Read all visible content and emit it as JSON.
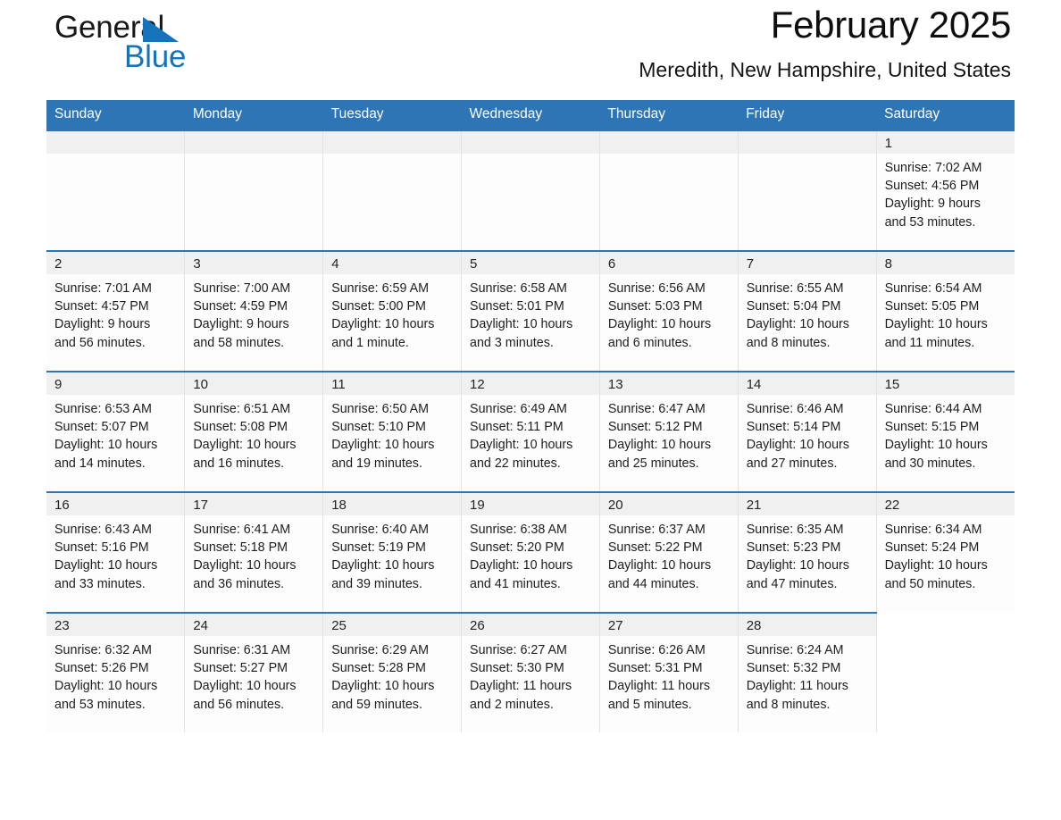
{
  "brand": {
    "word_one": "General",
    "word_two": "Blue",
    "logo_icon": "triangle-logo-icon"
  },
  "header": {
    "month_title": "February 2025",
    "location": "Meredith, New Hampshire, United States"
  },
  "colors": {
    "header_blue": "#2e75b6",
    "brand_blue": "#1573b9",
    "daynum_band": "#f0f0f0",
    "cell_background": "#fdfdfe",
    "cell_border": "#e2e2e2"
  },
  "weekdays": [
    "Sunday",
    "Monday",
    "Tuesday",
    "Wednesday",
    "Thursday",
    "Friday",
    "Saturday"
  ],
  "weeks": [
    [
      {
        "day": "",
        "sunrise": "",
        "sunset": "",
        "daylight_line1": "",
        "daylight_line2": ""
      },
      {
        "day": "",
        "sunrise": "",
        "sunset": "",
        "daylight_line1": "",
        "daylight_line2": ""
      },
      {
        "day": "",
        "sunrise": "",
        "sunset": "",
        "daylight_line1": "",
        "daylight_line2": ""
      },
      {
        "day": "",
        "sunrise": "",
        "sunset": "",
        "daylight_line1": "",
        "daylight_line2": ""
      },
      {
        "day": "",
        "sunrise": "",
        "sunset": "",
        "daylight_line1": "",
        "daylight_line2": ""
      },
      {
        "day": "",
        "sunrise": "",
        "sunset": "",
        "daylight_line1": "",
        "daylight_line2": ""
      },
      {
        "day": "1",
        "sunrise": "Sunrise: 7:02 AM",
        "sunset": "Sunset: 4:56 PM",
        "daylight_line1": "Daylight: 9 hours",
        "daylight_line2": "and 53 minutes."
      }
    ],
    [
      {
        "day": "2",
        "sunrise": "Sunrise: 7:01 AM",
        "sunset": "Sunset: 4:57 PM",
        "daylight_line1": "Daylight: 9 hours",
        "daylight_line2": "and 56 minutes."
      },
      {
        "day": "3",
        "sunrise": "Sunrise: 7:00 AM",
        "sunset": "Sunset: 4:59 PM",
        "daylight_line1": "Daylight: 9 hours",
        "daylight_line2": "and 58 minutes."
      },
      {
        "day": "4",
        "sunrise": "Sunrise: 6:59 AM",
        "sunset": "Sunset: 5:00 PM",
        "daylight_line1": "Daylight: 10 hours",
        "daylight_line2": "and 1 minute."
      },
      {
        "day": "5",
        "sunrise": "Sunrise: 6:58 AM",
        "sunset": "Sunset: 5:01 PM",
        "daylight_line1": "Daylight: 10 hours",
        "daylight_line2": "and 3 minutes."
      },
      {
        "day": "6",
        "sunrise": "Sunrise: 6:56 AM",
        "sunset": "Sunset: 5:03 PM",
        "daylight_line1": "Daylight: 10 hours",
        "daylight_line2": "and 6 minutes."
      },
      {
        "day": "7",
        "sunrise": "Sunrise: 6:55 AM",
        "sunset": "Sunset: 5:04 PM",
        "daylight_line1": "Daylight: 10 hours",
        "daylight_line2": "and 8 minutes."
      },
      {
        "day": "8",
        "sunrise": "Sunrise: 6:54 AM",
        "sunset": "Sunset: 5:05 PM",
        "daylight_line1": "Daylight: 10 hours",
        "daylight_line2": "and 11 minutes."
      }
    ],
    [
      {
        "day": "9",
        "sunrise": "Sunrise: 6:53 AM",
        "sunset": "Sunset: 5:07 PM",
        "daylight_line1": "Daylight: 10 hours",
        "daylight_line2": "and 14 minutes."
      },
      {
        "day": "10",
        "sunrise": "Sunrise: 6:51 AM",
        "sunset": "Sunset: 5:08 PM",
        "daylight_line1": "Daylight: 10 hours",
        "daylight_line2": "and 16 minutes."
      },
      {
        "day": "11",
        "sunrise": "Sunrise: 6:50 AM",
        "sunset": "Sunset: 5:10 PM",
        "daylight_line1": "Daylight: 10 hours",
        "daylight_line2": "and 19 minutes."
      },
      {
        "day": "12",
        "sunrise": "Sunrise: 6:49 AM",
        "sunset": "Sunset: 5:11 PM",
        "daylight_line1": "Daylight: 10 hours",
        "daylight_line2": "and 22 minutes."
      },
      {
        "day": "13",
        "sunrise": "Sunrise: 6:47 AM",
        "sunset": "Sunset: 5:12 PM",
        "daylight_line1": "Daylight: 10 hours",
        "daylight_line2": "and 25 minutes."
      },
      {
        "day": "14",
        "sunrise": "Sunrise: 6:46 AM",
        "sunset": "Sunset: 5:14 PM",
        "daylight_line1": "Daylight: 10 hours",
        "daylight_line2": "and 27 minutes."
      },
      {
        "day": "15",
        "sunrise": "Sunrise: 6:44 AM",
        "sunset": "Sunset: 5:15 PM",
        "daylight_line1": "Daylight: 10 hours",
        "daylight_line2": "and 30 minutes."
      }
    ],
    [
      {
        "day": "16",
        "sunrise": "Sunrise: 6:43 AM",
        "sunset": "Sunset: 5:16 PM",
        "daylight_line1": "Daylight: 10 hours",
        "daylight_line2": "and 33 minutes."
      },
      {
        "day": "17",
        "sunrise": "Sunrise: 6:41 AM",
        "sunset": "Sunset: 5:18 PM",
        "daylight_line1": "Daylight: 10 hours",
        "daylight_line2": "and 36 minutes."
      },
      {
        "day": "18",
        "sunrise": "Sunrise: 6:40 AM",
        "sunset": "Sunset: 5:19 PM",
        "daylight_line1": "Daylight: 10 hours",
        "daylight_line2": "and 39 minutes."
      },
      {
        "day": "19",
        "sunrise": "Sunrise: 6:38 AM",
        "sunset": "Sunset: 5:20 PM",
        "daylight_line1": "Daylight: 10 hours",
        "daylight_line2": "and 41 minutes."
      },
      {
        "day": "20",
        "sunrise": "Sunrise: 6:37 AM",
        "sunset": "Sunset: 5:22 PM",
        "daylight_line1": "Daylight: 10 hours",
        "daylight_line2": "and 44 minutes."
      },
      {
        "day": "21",
        "sunrise": "Sunrise: 6:35 AM",
        "sunset": "Sunset: 5:23 PM",
        "daylight_line1": "Daylight: 10 hours",
        "daylight_line2": "and 47 minutes."
      },
      {
        "day": "22",
        "sunrise": "Sunrise: 6:34 AM",
        "sunset": "Sunset: 5:24 PM",
        "daylight_line1": "Daylight: 10 hours",
        "daylight_line2": "and 50 minutes."
      }
    ],
    [
      {
        "day": "23",
        "sunrise": "Sunrise: 6:32 AM",
        "sunset": "Sunset: 5:26 PM",
        "daylight_line1": "Daylight: 10 hours",
        "daylight_line2": "and 53 minutes."
      },
      {
        "day": "24",
        "sunrise": "Sunrise: 6:31 AM",
        "sunset": "Sunset: 5:27 PM",
        "daylight_line1": "Daylight: 10 hours",
        "daylight_line2": "and 56 minutes."
      },
      {
        "day": "25",
        "sunrise": "Sunrise: 6:29 AM",
        "sunset": "Sunset: 5:28 PM",
        "daylight_line1": "Daylight: 10 hours",
        "daylight_line2": "and 59 minutes."
      },
      {
        "day": "26",
        "sunrise": "Sunrise: 6:27 AM",
        "sunset": "Sunset: 5:30 PM",
        "daylight_line1": "Daylight: 11 hours",
        "daylight_line2": "and 2 minutes."
      },
      {
        "day": "27",
        "sunrise": "Sunrise: 6:26 AM",
        "sunset": "Sunset: 5:31 PM",
        "daylight_line1": "Daylight: 11 hours",
        "daylight_line2": "and 5 minutes."
      },
      {
        "day": "28",
        "sunrise": "Sunrise: 6:24 AM",
        "sunset": "Sunset: 5:32 PM",
        "daylight_line1": "Daylight: 11 hours",
        "daylight_line2": "and 8 minutes."
      },
      {
        "day": "",
        "sunrise": "",
        "sunset": "",
        "daylight_line1": "",
        "daylight_line2": ""
      }
    ]
  ]
}
